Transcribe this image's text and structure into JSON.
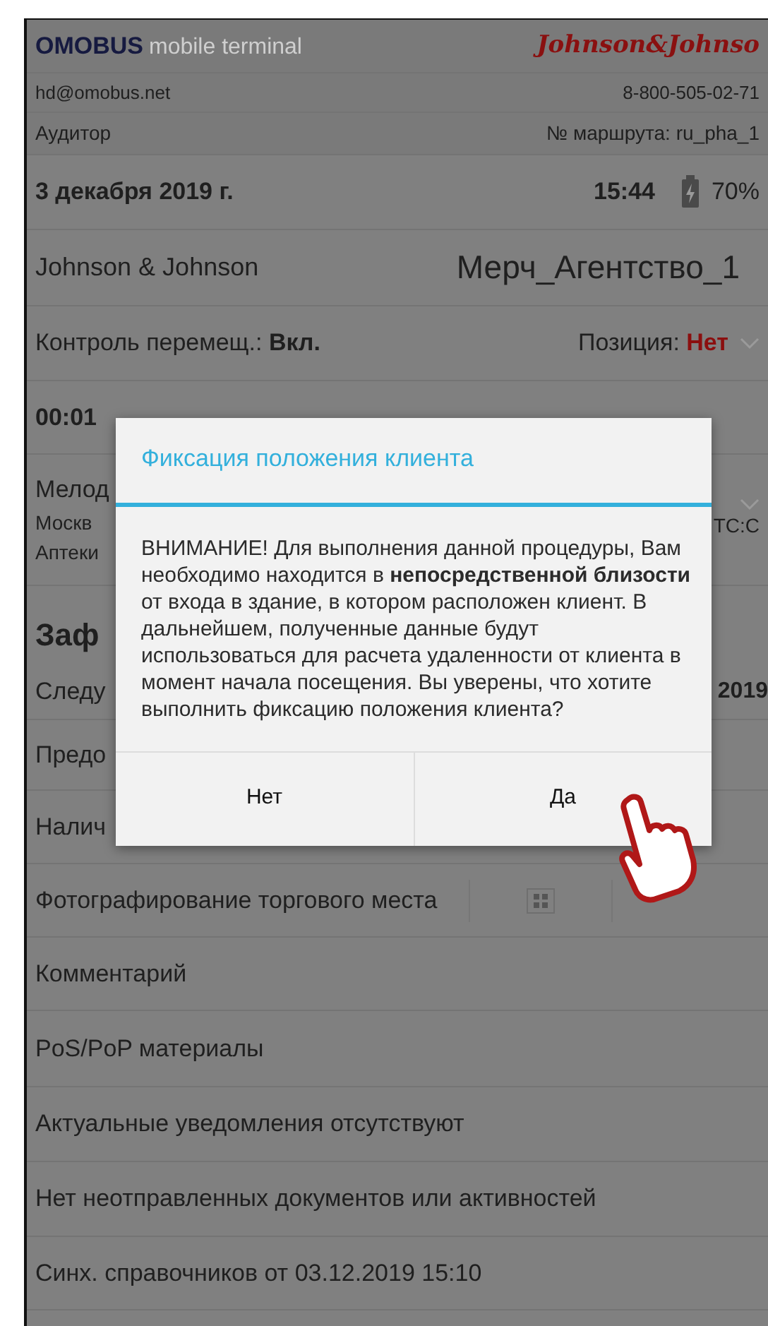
{
  "header": {
    "brand": "OMOBUS",
    "subtitle": "mobile terminal",
    "logo": "Johnson&Johnso",
    "email": "hd@omobus.net",
    "phone": "8-800-505-02-71",
    "role": "Аудитор",
    "route": "№ маршрута: ru_pha_1"
  },
  "status": {
    "date": "3 декабря 2019 г.",
    "time": "15:44",
    "battery": "70%"
  },
  "account": {
    "company": "Johnson & Johnson",
    "agent": "Мерч_Агентство_1"
  },
  "tracking": {
    "label": "Контроль перемещ.:",
    "value": "Вкл.",
    "position_label": "Позиция:",
    "position_value": "Нет"
  },
  "timer": "00:01",
  "client": {
    "lines": [
      "Мелод",
      "Москв",
      "Аптеки"
    ],
    "right": "ТС:С"
  },
  "section": {
    "title": "Заф",
    "next_label": "Следу",
    "next_value": "2019"
  },
  "menu_items": [
    {
      "kind": "text",
      "label": "Предо"
    },
    {
      "kind": "text",
      "label": "Налич"
    },
    {
      "kind": "photo",
      "label": "Фотографирование торгового места"
    },
    {
      "kind": "text",
      "label": "Комментарий"
    },
    {
      "kind": "text",
      "label": "PoS/PoP материалы"
    },
    {
      "kind": "text",
      "label": "Актуальные уведомления отсутствуют"
    },
    {
      "kind": "text",
      "label": "Нет неотправленных документов или активностей"
    },
    {
      "kind": "text",
      "label": "Синх. справочников от 03.12.2019 15:10"
    }
  ],
  "dialog": {
    "title": "Фиксация положения клиента",
    "message": "ВНИМАНИЕ! Для выполнения данной процедуры, Вам необходимо находится в **непосредственной близости** от входа в здание, в котором расположен клиент. В дальнейшем, полученные данные будут использоваться для расчета удаленности от клиента в момент начала посещения. Вы уверены, что хотите выполнить фиксацию положения клиента?",
    "buttons": [
      "Нет",
      "Да"
    ]
  }
}
